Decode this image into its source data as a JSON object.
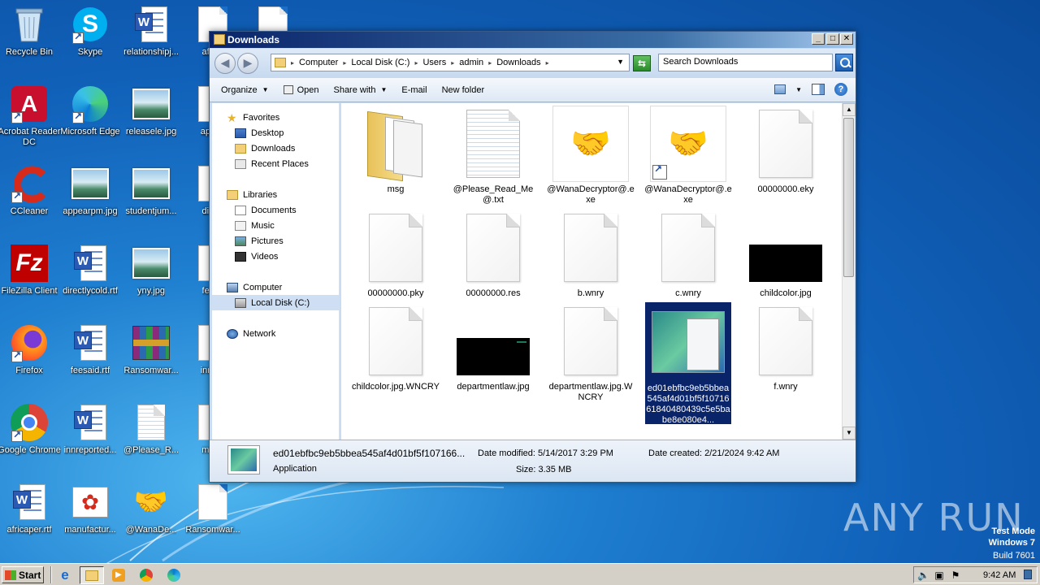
{
  "desktop": {
    "icons": [
      {
        "label": "Recycle Bin",
        "icon": "recycle-bin-icon"
      },
      {
        "label": "Skype",
        "icon": "skype-icon"
      },
      {
        "label": "relationshipj...",
        "icon": "word-doc-icon"
      },
      {
        "label": "africa",
        "icon": "doc-icon"
      },
      {
        "label": "Acrobat Reader DC",
        "icon": "acrobat-icon"
      },
      {
        "label": "Microsoft Edge",
        "icon": "edge-icon"
      },
      {
        "label": "releasele.jpg",
        "icon": "image-icon"
      },
      {
        "label": "appea",
        "icon": "doc-icon"
      },
      {
        "label": "CCleaner",
        "icon": "ccleaner-icon"
      },
      {
        "label": "appearpm.jpg",
        "icon": "image-icon"
      },
      {
        "label": "studentjum...",
        "icon": "image-icon"
      },
      {
        "label": "direct",
        "icon": "doc-icon"
      },
      {
        "label": "FileZilla Client",
        "icon": "filezilla-icon"
      },
      {
        "label": "directlycold.rtf",
        "icon": "word-doc-icon"
      },
      {
        "label": "yny.jpg",
        "icon": "image-icon"
      },
      {
        "label": "feesa",
        "icon": "doc-icon"
      },
      {
        "label": "Firefox",
        "icon": "firefox-icon"
      },
      {
        "label": "feesaid.rtf",
        "icon": "word-doc-icon"
      },
      {
        "label": "Ransomwar...",
        "icon": "winrar-icon"
      },
      {
        "label": "innrep",
        "icon": "doc-icon"
      },
      {
        "label": "Google Chrome",
        "icon": "chrome-icon"
      },
      {
        "label": "innreported...",
        "icon": "word-doc-icon"
      },
      {
        "label": "@Please_R...",
        "icon": "text-doc-icon"
      },
      {
        "label": "manu",
        "icon": "doc-icon"
      },
      {
        "label": "africaper.rtf",
        "icon": "word-doc-icon"
      },
      {
        "label": "manufactur...",
        "icon": "flower-image-icon"
      },
      {
        "label": "@WanaDe...",
        "icon": "handshake-icon"
      },
      {
        "label": "Ransomwar...",
        "icon": "doc-icon"
      }
    ]
  },
  "window": {
    "title": "Downloads",
    "breadcrumb": [
      "Computer",
      "Local Disk (C:)",
      "Users",
      "admin",
      "Downloads"
    ],
    "search_placeholder": "Search Downloads",
    "toolbar": {
      "organize": "Organize",
      "open": "Open",
      "share_with": "Share with",
      "email": "E-mail",
      "new_folder": "New folder"
    },
    "nav": {
      "favorites": "Favorites",
      "desktop": "Desktop",
      "downloads": "Downloads",
      "recent_places": "Recent Places",
      "libraries": "Libraries",
      "documents": "Documents",
      "music": "Music",
      "pictures": "Pictures",
      "videos": "Videos",
      "computer": "Computer",
      "local_disk": "Local Disk (C:)",
      "network": "Network"
    },
    "files": [
      {
        "name": "msg",
        "type": "folder"
      },
      {
        "name": "@Please_Read_Me@.txt",
        "type": "text"
      },
      {
        "name": "@WanaDecryptor@.exe",
        "type": "exe"
      },
      {
        "name": "@WanaDecryptor@.exe",
        "type": "exe-shortcut"
      },
      {
        "name": "00000000.eky",
        "type": "blank"
      },
      {
        "name": "00000000.pky",
        "type": "blank"
      },
      {
        "name": "00000000.res",
        "type": "blank"
      },
      {
        "name": "b.wnry",
        "type": "blank"
      },
      {
        "name": "c.wnry",
        "type": "blank"
      },
      {
        "name": "childcolor.jpg",
        "type": "black-image"
      },
      {
        "name": "childcolor.jpg.WNCRY",
        "type": "blank"
      },
      {
        "name": "departmentlaw.jpg",
        "type": "black-image"
      },
      {
        "name": "departmentlaw.jpg.WNCRY",
        "type": "blank"
      },
      {
        "name": "ed01ebfbc9eb5bbea545af4d01bf5f1071661840480439c5e5babe8e080e4...",
        "type": "screenshot",
        "selected": true
      },
      {
        "name": "f.wnry",
        "type": "blank"
      }
    ],
    "details": {
      "name": "ed01ebfbc9eb5bbea545af4d01bf5f107166...",
      "type": "Application",
      "date_modified": "Date modified: 5/14/2017 3:29 PM",
      "size": "Size: 3.35 MB",
      "date_created": "Date created: 2/21/2024 9:42 AM"
    }
  },
  "taskbar": {
    "start": "Start",
    "clock": "9:42 AM"
  },
  "watermark": {
    "line1": "Test Mode",
    "line2": "Windows 7",
    "line3": "Build 7601",
    "brand": "ANY RUN"
  }
}
